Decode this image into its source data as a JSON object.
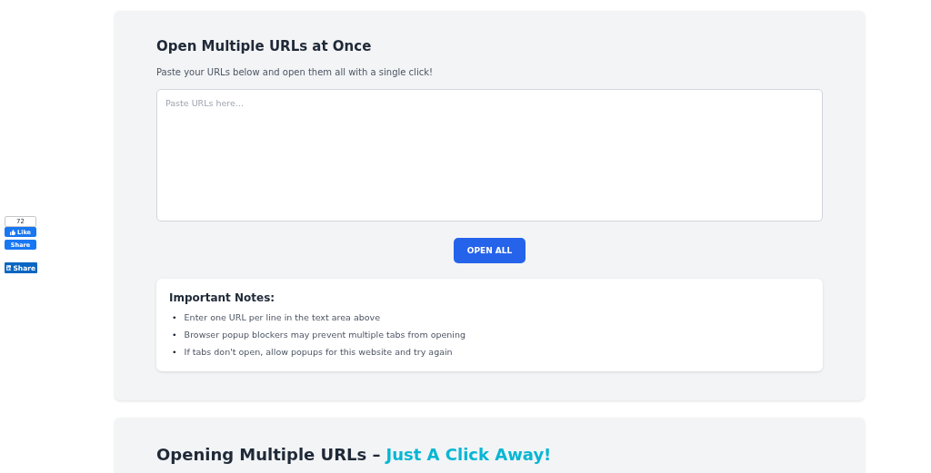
{
  "social": {
    "like_count": "72",
    "like_label": "Like",
    "share_label": "Share",
    "linkedin_label": "Share"
  },
  "tool": {
    "title": "Open Multiple URLs at Once",
    "subtitle": "Paste your URLs below and open them all with a single click!",
    "placeholder": "Paste URLs here...",
    "button": "OPEN ALL",
    "notes": {
      "title": "Important Notes:",
      "items": [
        {
          "bullet": "•",
          "text": "Enter one URL per line in the text area above"
        },
        {
          "bullet": "•",
          "text": "Browser popup blockers may prevent multiple tabs from opening"
        },
        {
          "bullet": "•",
          "text": "If tabs don't open, allow popups for this website and try again"
        }
      ]
    }
  },
  "article": {
    "heading": "Opening Multiple URLs –",
    "highlight": "Just A Click Away!"
  }
}
